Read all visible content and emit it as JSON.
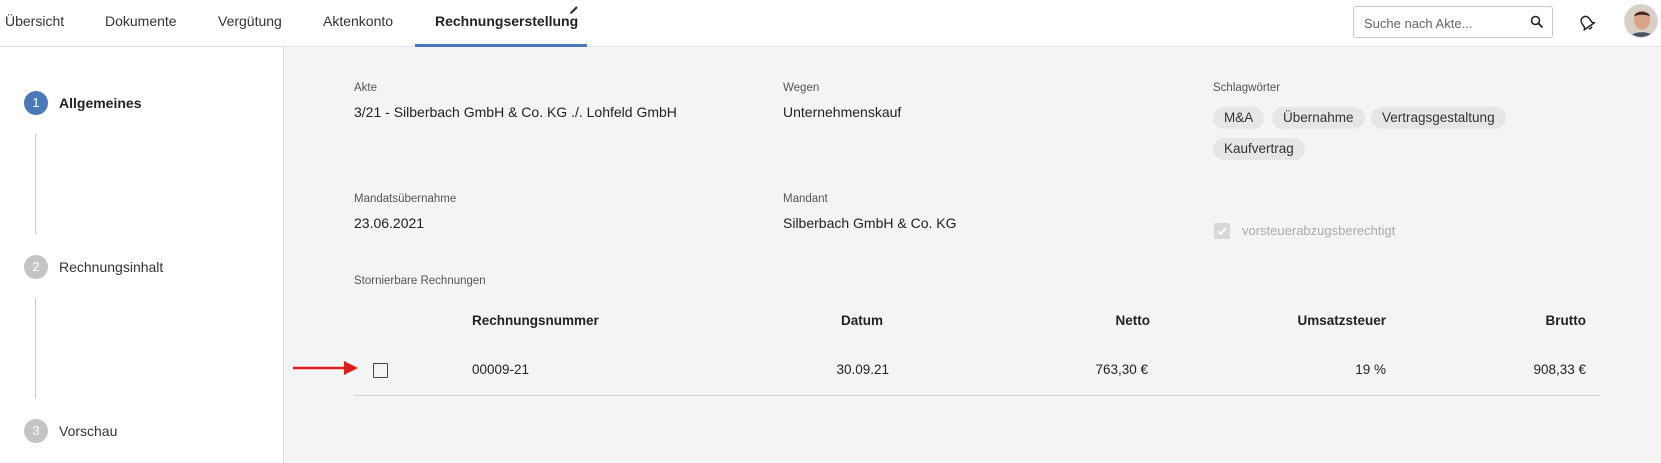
{
  "nav": {
    "tabs": [
      {
        "label": "Übersicht"
      },
      {
        "label": "Dokumente"
      },
      {
        "label": "Vergütung"
      },
      {
        "label": "Aktenkonto"
      },
      {
        "label": "Rechnungserstellung",
        "active": true
      }
    ],
    "active_tab_icon": "pencil-icon",
    "search_placeholder": "Suche nach Akte...",
    "accent_color": "#4a78b8"
  },
  "steps": [
    {
      "number": "1",
      "label": "Allgemeines",
      "active": true
    },
    {
      "number": "2",
      "label": "Rechnungsinhalt"
    },
    {
      "number": "3",
      "label": "Vorschau"
    }
  ],
  "fields": {
    "akte": {
      "label": "Akte",
      "value": "3/21 - Silberbach GmbH & Co. KG ./. Lohfeld GmbH"
    },
    "wegen": {
      "label": "Wegen",
      "value": "Unternehmenskauf"
    },
    "schlagwoerter": {
      "label": "Schlagwörter",
      "tags": [
        "M&A",
        "Übernahme",
        "Vertragsgestaltung",
        "Kaufvertrag"
      ]
    },
    "mandatsuebernahme": {
      "label": "Mandatsübernahme",
      "value": "23.06.2021"
    },
    "mandant": {
      "label": "Mandant",
      "value": "Silberbach GmbH & Co. KG"
    },
    "vorsteuer": {
      "label": "vorsteuerabzugsberechtigt",
      "checked": true,
      "disabled": true
    }
  },
  "invoices": {
    "title": "Stornierbare Rechnungen",
    "columns": [
      "Rechnungsnummer",
      "Datum",
      "Netto",
      "Umsatzsteuer",
      "Brutto"
    ],
    "rows": [
      {
        "selected": false,
        "nummer": "00009-21",
        "datum": "30.09.21",
        "netto": "763,30 €",
        "ust": "19 %",
        "brutto": "908,33 €"
      }
    ]
  },
  "annotation": {
    "arrow_color": "#e31b1b"
  }
}
